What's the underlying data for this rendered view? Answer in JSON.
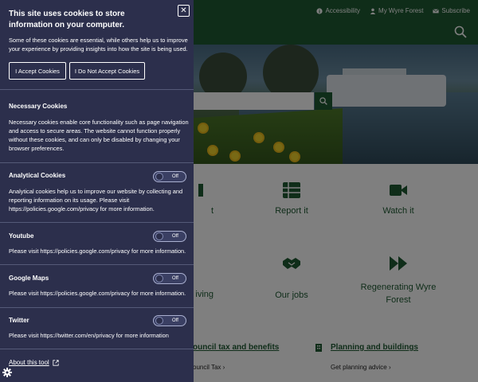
{
  "site": {
    "top_links": [
      {
        "label": "Accessibility",
        "icon": "info-icon"
      },
      {
        "label": "My Wyre Forest",
        "icon": "user-icon"
      },
      {
        "label": "Subscribe",
        "icon": "mail-icon"
      }
    ],
    "tiles_row1": [
      {
        "label": "t",
        "icon": "partial-icon"
      },
      {
        "label": "Report it",
        "icon": "list-icon"
      },
      {
        "label": "Watch it",
        "icon": "video-icon"
      }
    ],
    "tiles_row2": [
      {
        "label": "iving",
        "icon": "partial-icon"
      },
      {
        "label": "Our jobs",
        "icon": "handshake-icon"
      },
      {
        "label": "Regenerating Wyre Forest",
        "icon": "fast-forward-icon"
      }
    ],
    "sections": [
      {
        "title": "ouncil tax and benefits",
        "link": "ouncil Tax"
      },
      {
        "title": "Planning and buildings",
        "link": "Get planning advice"
      }
    ],
    "colors": {
      "brand": "#1f5a33",
      "panel": "#2c2f4c"
    }
  },
  "cookie_panel": {
    "title": "This site uses cookies to store information on your computer.",
    "intro": "Some of these cookies are essential, while others help us to improve your experience by providing insights into how the site is being used.",
    "accept_label": "I Accept Cookies",
    "decline_label": "I Do Not Accept Cookies",
    "necessary": {
      "title": "Necessary Cookies",
      "text": "Necessary cookies enable core functionality such as page navigation and access to secure areas. The website cannot function properly without these cookies, and can only be disabled by changing your browser preferences."
    },
    "analytical": {
      "title": "Analytical Cookies",
      "text": "Analytical cookies help us to improve our website by collecting and reporting information on its usage. Please visit https://policies.google.com/privacy for more information.",
      "toggle": "Off"
    },
    "youtube": {
      "title": "Youtube",
      "text": "Please visit https://policies.google.com/privacy for more information.",
      "toggle": "Off"
    },
    "googlemaps": {
      "title": "Google Maps",
      "text": "Please visit https://policies.google.com/privacy for more information.",
      "toggle": "Off"
    },
    "twitter": {
      "title": "Twitter",
      "text": "Please visit https://twitter.com/en/privacy for more information",
      "toggle": "Off"
    },
    "about_label": "About this tool",
    "close_symbol": "✕"
  }
}
